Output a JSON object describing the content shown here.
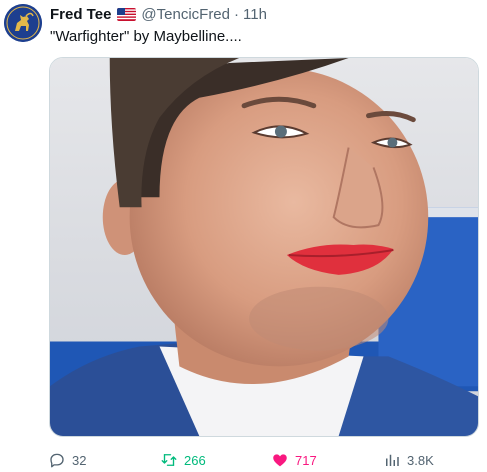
{
  "author": {
    "display_name": "Fred Tee",
    "handle": "@TencicFred",
    "separator": "·",
    "time": "11h",
    "flag_icon": "us-flag-icon",
    "avatar_icon": "gold-goat-emblem-icon",
    "avatar_bg": "#1d3f8f"
  },
  "tweet": {
    "text": "\"Warfighter\" by Maybelline...."
  },
  "media": {
    "description_icon": "photo-smiling-man-red-lipstick-icon"
  },
  "actions": {
    "reply": {
      "icon": "reply-bubble-icon",
      "count": "32"
    },
    "retweet": {
      "icon": "retweet-icon",
      "count": "266",
      "color": "#00ba7c"
    },
    "like": {
      "icon": "heart-filled-icon",
      "count": "717",
      "color": "#f91880"
    },
    "views": {
      "icon": "views-bar-chart-icon",
      "count": "3.8K"
    }
  }
}
